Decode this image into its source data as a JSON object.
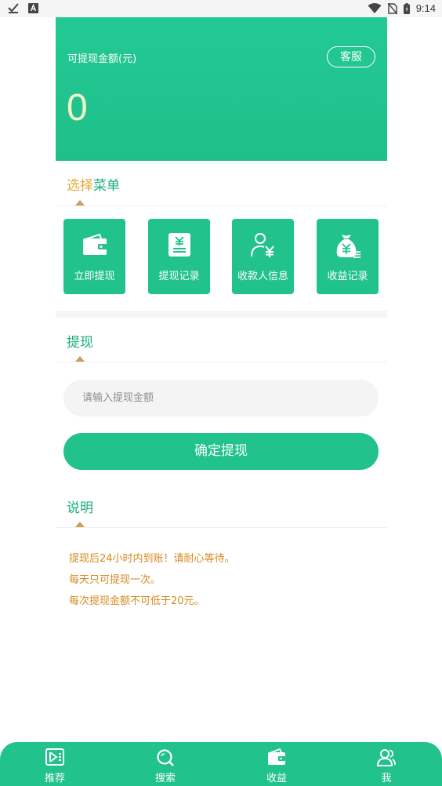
{
  "status_bar": {
    "time": "9:14"
  },
  "balance": {
    "label": "可提现金额(元)",
    "amount": "0",
    "service_label": "客服"
  },
  "menu_section": {
    "title_part1": "选择",
    "title_part2": "菜单"
  },
  "menu": [
    {
      "label": "立即提现",
      "icon": "wallet-icon"
    },
    {
      "label": "提现记录",
      "icon": "receipt-icon"
    },
    {
      "label": "收款人信息",
      "icon": "payee-icon"
    },
    {
      "label": "收益记录",
      "icon": "money-bag-icon"
    }
  ],
  "withdraw_section": {
    "title": "提现"
  },
  "withdraw": {
    "placeholder": "请输入提现金额",
    "value": "",
    "confirm_label": "确定提现"
  },
  "notes_section": {
    "title": "说明"
  },
  "notes": [
    "提现后24小时内到账！请耐心等待。",
    "每天只可提现一次。",
    "每次提现金额不可低于20元。"
  ],
  "bottom_nav": [
    {
      "label": "推荐",
      "icon": "video-icon"
    },
    {
      "label": "搜索",
      "icon": "search-icon"
    },
    {
      "label": "收益",
      "icon": "wallet-icon"
    },
    {
      "label": "我",
      "icon": "user-icon"
    }
  ],
  "colors": {
    "brand_green": "#21c28c",
    "accent_gold": "#e6a93a",
    "note_text": "#d48a1f",
    "amount_text": "#f7f3c9"
  }
}
